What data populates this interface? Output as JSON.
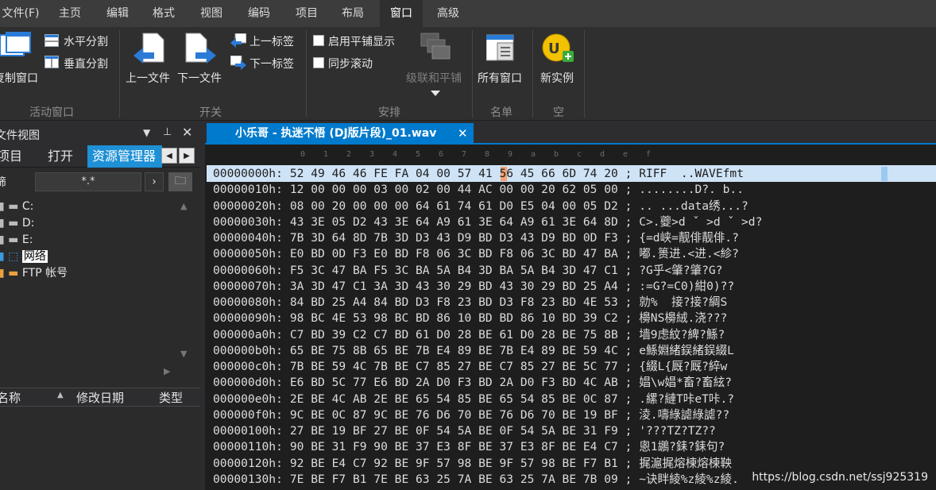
{
  "menu": {
    "items": [
      "文件(F)",
      "主页",
      "编辑",
      "格式",
      "视图",
      "编码",
      "项目",
      "布局",
      "窗口",
      "高级"
    ],
    "active": "窗口"
  },
  "ribbon": {
    "groups": {
      "active_windows": {
        "label": "活动窗口",
        "duplicate_window": "复制窗口",
        "horizontal_split": "水平分割",
        "vertical_split": "垂直分割"
      },
      "switch": {
        "label": "开关",
        "prev_file": "上一文件",
        "next_file": "下一文件",
        "prev_tab": "上一标签",
        "next_tab": "下一标签"
      },
      "arrange": {
        "label": "安排",
        "tile_display": "启用平铺显示",
        "sync_scroll": "同步滚动",
        "cascade_tile": "级联和平铺"
      },
      "list": {
        "label": "名单",
        "all_windows": "所有窗口"
      },
      "empty": {
        "label": "空",
        "new_instance": "新实例"
      }
    }
  },
  "left_panel": {
    "title": "文件视图",
    "pin_icon": "pin-icon",
    "close_icon": "close-icon",
    "tabs": [
      "项目",
      "打开",
      "资源管理器"
    ],
    "active_tab": "资源管理器",
    "filter_label": "筛",
    "filter_value": "*.*",
    "tree": [
      {
        "label": "C:",
        "icon": "drive-icon"
      },
      {
        "label": "D:",
        "icon": "drive-icon"
      },
      {
        "label": "E:",
        "icon": "drive-icon"
      },
      {
        "label": "网络",
        "icon": "network-icon",
        "selected": true
      },
      {
        "label": "FTP 帐号",
        "icon": "ftp-icon"
      }
    ],
    "list_columns": [
      "名称",
      "修改日期",
      "类型"
    ]
  },
  "editor": {
    "tab_title": "小乐哥 - 执迷不悟 (DJ版片段)_01.wav",
    "ruler": [
      "0",
      "1",
      "2",
      "3",
      "4",
      "5",
      "6",
      "7",
      "8",
      "9",
      "a",
      "b",
      "c",
      "d",
      "e",
      "f"
    ],
    "lines": [
      {
        "addr": "00000000h:",
        "hex": "52 49 46 46 FE FA 04 00 57 41 56 45 66 6D 74 20",
        "text": "RIFF  ..WAVEfmt"
      },
      {
        "addr": "00000010h:",
        "hex": "12 00 00 00 03 00 02 00 44 AC 00 00 20 62 05 00",
        "text": "........D?. b.."
      },
      {
        "addr": "00000020h:",
        "hex": "08 00 20 00 00 00 64 61 74 61 D0 E5 04 00 05 D2",
        "text": ".. ...data绣...?"
      },
      {
        "addr": "00000030h:",
        "hex": "43 3E 05 D2 43 3E 64 A9 61 3E 64 A9 61 3E 64 8D",
        "text": "C>.夔>d ˇ >d ˇ >d?"
      },
      {
        "addr": "00000040h:",
        "hex": "7B 3D 64 8D 7B 3D D3 43 D9 BD D3 43 D9 BD 0D F3",
        "text": "{=d峡=靓俳靓俳.?"
      },
      {
        "addr": "00000050h:",
        "hex": "E0 BD 0D F3 E0 BD F8 06 3C BD F8 06 3C BD 47 BA",
        "text": "嘟.篑进.<进.<紾?"
      },
      {
        "addr": "00000060h:",
        "hex": "F5 3C 47 BA F5 3C BA 5A B4 3D BA 5A B4 3D 47 C1",
        "text": "?G乎<肇?肇?G?"
      },
      {
        "addr": "00000070h:",
        "hex": "3A 3D 47 C1 3A 3D 43 30 29 BD 43 30 29 BD 25 A4",
        "text": ":=G?=C0)紺0)??"
      },
      {
        "addr": "00000080h:",
        "hex": "84 BD 25 A4 84 BD D3 F8 23 BD D3 F8 23 BD 4E 53",
        "text": "勍%  接?接?綢S"
      },
      {
        "addr": "00000090h:",
        "hex": "98 BC 4E 53 98 BC BD 86 10 BD BD 86 10 BD 39 C2",
        "text": "櫋NS櫋絨.浇???"
      },
      {
        "addr": "000000a0h:",
        "hex": "C7 BD 39 C2 C7 BD 61 D0 28 BE 61 D0 28 BE 75 8B",
        "text": "墙9虑紋?綼?鯀?"
      },
      {
        "addr": "000000b0h:",
        "hex": "65 BE 75 8B 65 BE 7B E4 89 BE 7B E4 89 BE 59 4C",
        "text": "e鯀婣緒鋘緒鋘綴L"
      },
      {
        "addr": "000000c0h:",
        "hex": "7B BE 59 4C 7B BE C7 85 27 BE C7 85 27 BE 5C 77",
        "text": "{綴L{厩?厩?綷w"
      },
      {
        "addr": "000000d0h:",
        "hex": "E6 BD 5C 77 E6 BD 2A D0 F3 BD 2A D0 F3 BD 4C AB",
        "text": "娼\\w娼*畜?畜絃?"
      },
      {
        "addr": "000000e0h:",
        "hex": "2E BE 4C AB 2E BE 65 54 85 BE 65 54 85 BE 0C 87",
        "text": ".縲?縺T咔eT咔.?"
      },
      {
        "addr": "000000f0h:",
        "hex": "9C BE 0C 87 9C BE 76 D6 70 BE 76 D6 70 BE 19 BF",
        "text": "淩.嚋綠謔綠謔??"
      },
      {
        "addr": "00000100h:",
        "hex": "27 BE 19 BF 27 BE 0F 54 5A BE 0F 54 5A BE 31 F9",
        "text": "'???TZ?TZ??"
      },
      {
        "addr": "00000110h:",
        "hex": "90 BE 31 F9 90 BE 37 E3 8F BE 37 E3 8F BE E4 C7",
        "text": "悤1鶘?銇?銇句?"
      },
      {
        "addr": "00000120h:",
        "hex": "92 BE E4 C7 92 BE 9F 57 98 BE 9F 57 98 BE F7 B1",
        "text": "捤滬捤熔楝熔楝鞅"
      },
      {
        "addr": "00000130h:",
        "hex": "7E BE F7 B1 7E BE 63 25 7A BE 63 25 7A BE 7B 09",
        "text": "~诀眫綾%z綾%z綾."
      }
    ]
  },
  "watermark": "https://blog.csdn.net/ssj925319"
}
